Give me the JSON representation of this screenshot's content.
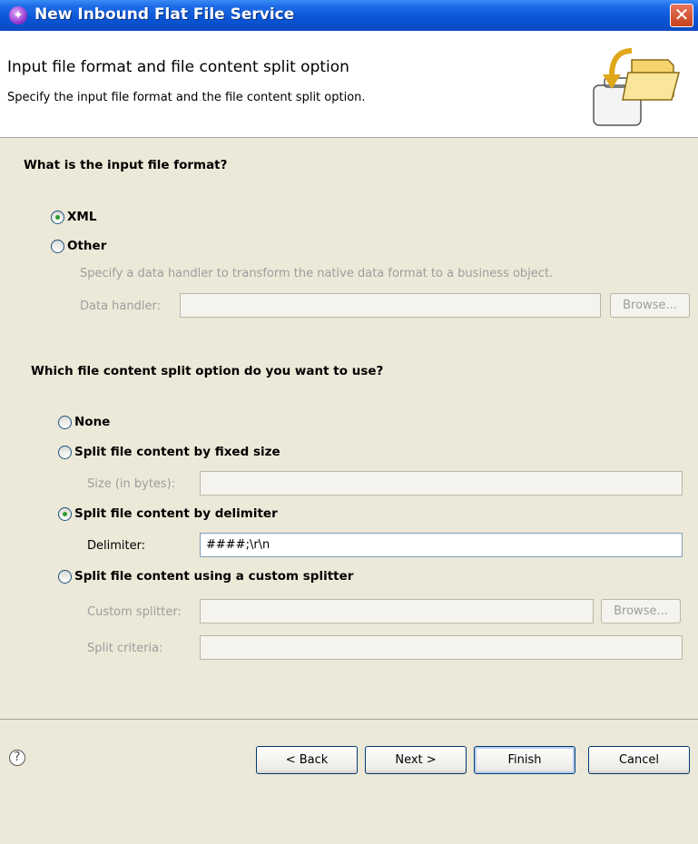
{
  "window": {
    "title": "New Inbound Flat File Service"
  },
  "header": {
    "title": "Input file format and file content split option",
    "description": "Specify the input file format and the file content split option."
  },
  "format_section": {
    "question": "What is the input file format?",
    "xml_label": "XML",
    "other_label": "Other",
    "hint": "Specify a data handler to transform the native data format to a business object.",
    "data_handler_label": "Data handler:",
    "data_handler_value": "",
    "browse_label": "Browse...",
    "selected": "XML"
  },
  "split_section": {
    "question": "Which file content split option do you want to use?",
    "none_label": "None",
    "fixed_label": "Split file content by fixed size",
    "size_label": "Size (in bytes):",
    "size_value": "",
    "delimiter_option_label": "Split file content by delimiter",
    "delimiter_label": "Delimiter:",
    "delimiter_value": "####;\\r\\n",
    "custom_label": "Split file content using a custom splitter",
    "custom_splitter_label": "Custom splitter:",
    "custom_splitter_value": "",
    "browse_label": "Browse...",
    "split_criteria_label": "Split criteria:",
    "split_criteria_value": "",
    "selected": "Split file content by delimiter"
  },
  "footer": {
    "help_icon": "?",
    "back_label": "< Back",
    "next_label": "Next >",
    "finish_label": "Finish",
    "cancel_label": "Cancel"
  },
  "icons": {
    "app": "purple-circle-icon",
    "close": "close-icon",
    "header_graphic": "folder-import-icon",
    "help": "help-icon"
  }
}
